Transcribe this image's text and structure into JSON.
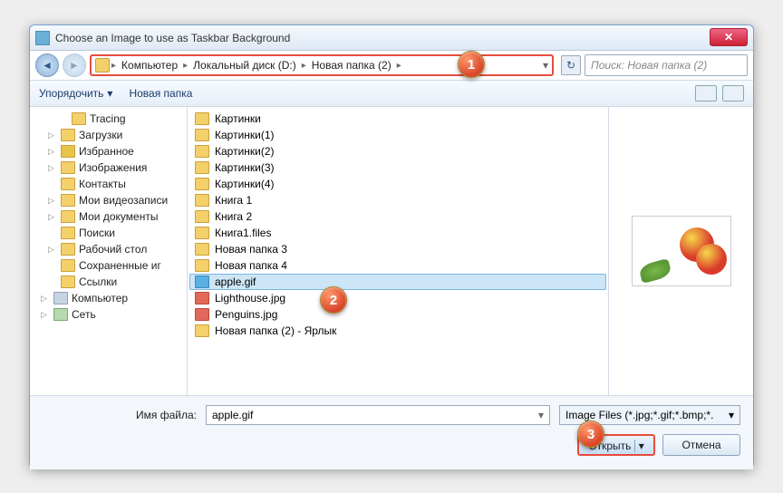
{
  "window": {
    "title": "Choose an Image to use as Taskbar Background"
  },
  "breadcrumb": {
    "root_icon": "folder",
    "segments": [
      "Компьютер",
      "Локальный диск (D:)",
      "Новая папка (2)"
    ]
  },
  "search": {
    "placeholder": "Поиск: Новая папка (2)"
  },
  "toolbar": {
    "organize": "Упорядочить",
    "new_folder": "Новая папка"
  },
  "tree": {
    "items": [
      {
        "label": "Tracing",
        "icon": "folder",
        "sub": true
      },
      {
        "label": "Загрузки",
        "icon": "folder",
        "sub": false,
        "caret": "▷"
      },
      {
        "label": "Избранное",
        "icon": "star",
        "sub": false,
        "caret": "▷"
      },
      {
        "label": "Изображения",
        "icon": "folder",
        "sub": false,
        "caret": "▷"
      },
      {
        "label": "Контакты",
        "icon": "folder",
        "sub": false
      },
      {
        "label": "Мои видеозаписи",
        "icon": "folder",
        "sub": false,
        "caret": "▷"
      },
      {
        "label": "Мои документы",
        "icon": "folder",
        "sub": false,
        "caret": "▷"
      },
      {
        "label": "Поиски",
        "icon": "folder",
        "sub": false
      },
      {
        "label": "Рабочий стол",
        "icon": "folder",
        "sub": false,
        "caret": "▷"
      },
      {
        "label": "Сохраненные иг",
        "icon": "folder",
        "sub": false
      },
      {
        "label": "Ссылки",
        "icon": "folder",
        "sub": false
      },
      {
        "label": "Компьютер",
        "icon": "comp",
        "sub": false,
        "caret": "▷",
        "root": true
      },
      {
        "label": "Сеть",
        "icon": "net",
        "sub": false,
        "caret": "▷",
        "root": true
      }
    ]
  },
  "files": [
    {
      "name": "Картинки",
      "type": "folder"
    },
    {
      "name": "Картинки(1)",
      "type": "folder"
    },
    {
      "name": "Картинки(2)",
      "type": "folder"
    },
    {
      "name": "Картинки(3)",
      "type": "folder"
    },
    {
      "name": "Картинки(4)",
      "type": "folder"
    },
    {
      "name": "Книга 1",
      "type": "folder"
    },
    {
      "name": "Книга 2",
      "type": "folder"
    },
    {
      "name": "Книга1.files",
      "type": "folder"
    },
    {
      "name": "Новая папка 3",
      "type": "folder"
    },
    {
      "name": "Новая папка 4",
      "type": "folder"
    },
    {
      "name": "apple.gif",
      "type": "gif",
      "selected": true
    },
    {
      "name": "Lighthouse.jpg",
      "type": "jpg"
    },
    {
      "name": "Penguins.jpg",
      "type": "jpg"
    },
    {
      "name": "Новая папка (2) - Ярлык",
      "type": "folder"
    }
  ],
  "filename": {
    "label": "Имя файла:",
    "value": "apple.gif"
  },
  "filter": {
    "label": "Image Files (*.jpg;*.gif;*.bmp;*."
  },
  "buttons": {
    "open": "Открыть",
    "cancel": "Отмена"
  },
  "markers": {
    "m1": "1",
    "m2": "2",
    "m3": "3"
  }
}
